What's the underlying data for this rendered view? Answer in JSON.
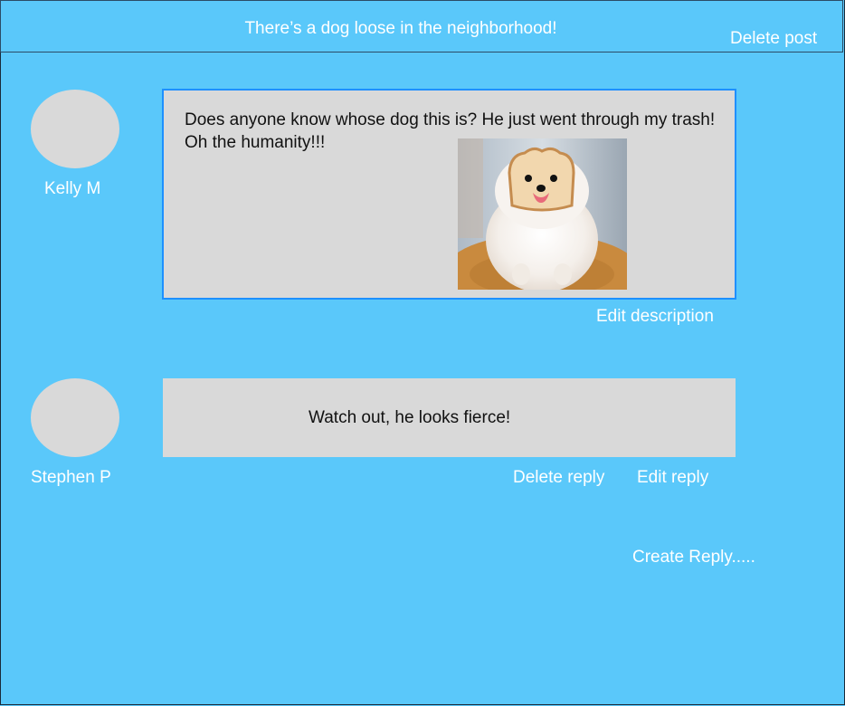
{
  "post": {
    "title": "There’s a dog loose in the neighborhood!",
    "delete_label": "Delete post",
    "author": "Kelly M",
    "description": "Does anyone know whose dog this is?  He just went through my trash!  Oh the humanity!!!",
    "edit_label": "Edit description",
    "image_icon": "dog-photo"
  },
  "reply": {
    "author": "Stephen P",
    "text": "Watch out, he looks fierce!",
    "delete_label": "Delete reply",
    "edit_label": "Edit reply"
  },
  "create_reply_label": "Create Reply.....",
  "colors": {
    "background": "#5ac8fa",
    "box": "#d9d9d9",
    "post_border": "#1e90ff",
    "avatar": "#d9d9d9"
  }
}
